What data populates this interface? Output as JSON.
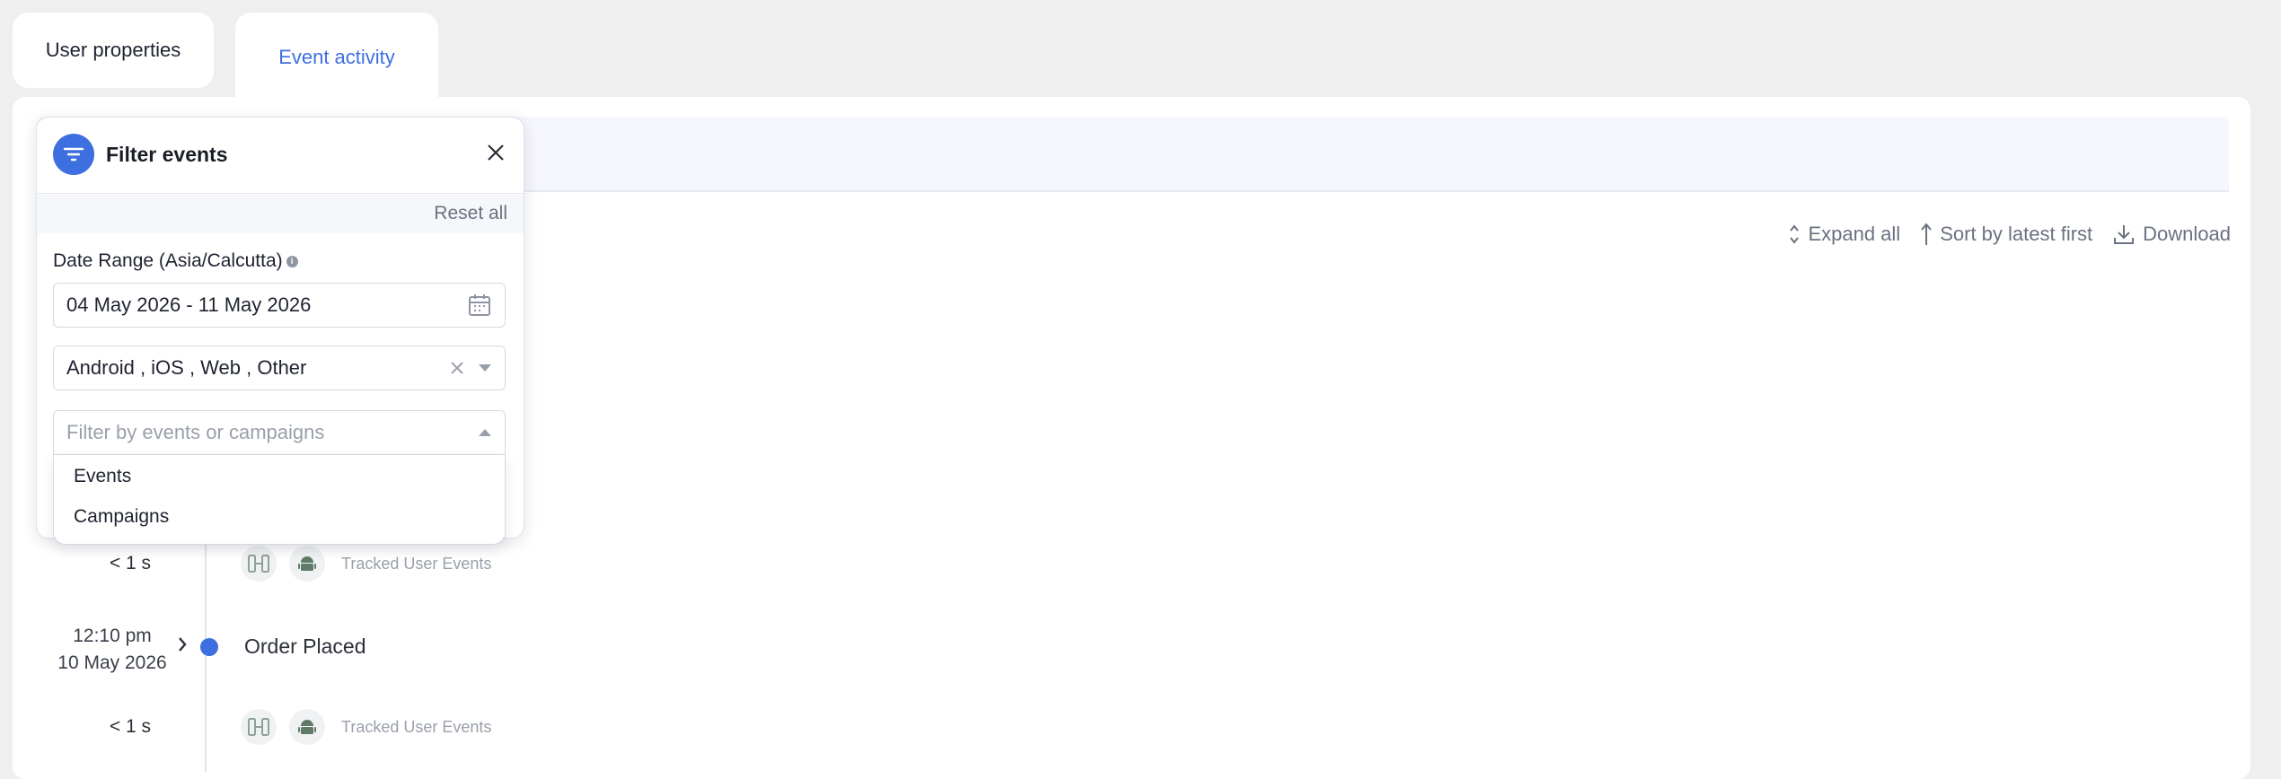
{
  "tabs": [
    {
      "label": "User properties",
      "active": false
    },
    {
      "label": "Event activity",
      "active": true
    }
  ],
  "toolbar": {
    "expand_all": "Expand all",
    "sort": "Sort by latest first",
    "download": "Download"
  },
  "filter_panel": {
    "title": "Filter events",
    "reset": "Reset all",
    "date_label": "Date Range (Asia/Calcutta)",
    "date_value": "04 May 2026 - 11 May 2026",
    "platform_value": "Android , iOS , Web , Other",
    "search_placeholder": "Filter by events or campaigns",
    "options": [
      "Events",
      "Campaigns"
    ]
  },
  "timeline": {
    "rows": [
      {
        "duration": "< 1 s",
        "source": "Tracked User Events"
      },
      {
        "duration": "< 1 s",
        "source": "Tracked User Events"
      }
    ],
    "event": {
      "time": "12:10 pm",
      "date": "10 May 2026",
      "name": "Order Placed"
    }
  },
  "colors": {
    "accent": "#3d6fe0",
    "muted": "#6a7180"
  }
}
